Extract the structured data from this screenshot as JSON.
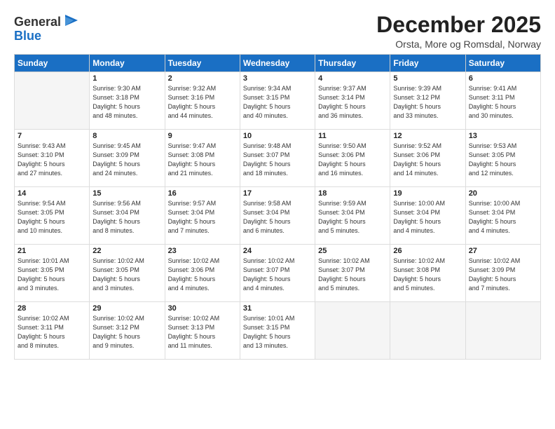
{
  "logo": {
    "general": "General",
    "blue": "Blue"
  },
  "header": {
    "month": "December 2025",
    "location": "Orsta, More og Romsdal, Norway"
  },
  "weekdays": [
    "Sunday",
    "Monday",
    "Tuesday",
    "Wednesday",
    "Thursday",
    "Friday",
    "Saturday"
  ],
  "weeks": [
    [
      {
        "num": "",
        "info": ""
      },
      {
        "num": "1",
        "info": "Sunrise: 9:30 AM\nSunset: 3:18 PM\nDaylight: 5 hours\nand 48 minutes."
      },
      {
        "num": "2",
        "info": "Sunrise: 9:32 AM\nSunset: 3:16 PM\nDaylight: 5 hours\nand 44 minutes."
      },
      {
        "num": "3",
        "info": "Sunrise: 9:34 AM\nSunset: 3:15 PM\nDaylight: 5 hours\nand 40 minutes."
      },
      {
        "num": "4",
        "info": "Sunrise: 9:37 AM\nSunset: 3:14 PM\nDaylight: 5 hours\nand 36 minutes."
      },
      {
        "num": "5",
        "info": "Sunrise: 9:39 AM\nSunset: 3:12 PM\nDaylight: 5 hours\nand 33 minutes."
      },
      {
        "num": "6",
        "info": "Sunrise: 9:41 AM\nSunset: 3:11 PM\nDaylight: 5 hours\nand 30 minutes."
      }
    ],
    [
      {
        "num": "7",
        "info": "Sunrise: 9:43 AM\nSunset: 3:10 PM\nDaylight: 5 hours\nand 27 minutes."
      },
      {
        "num": "8",
        "info": "Sunrise: 9:45 AM\nSunset: 3:09 PM\nDaylight: 5 hours\nand 24 minutes."
      },
      {
        "num": "9",
        "info": "Sunrise: 9:47 AM\nSunset: 3:08 PM\nDaylight: 5 hours\nand 21 minutes."
      },
      {
        "num": "10",
        "info": "Sunrise: 9:48 AM\nSunset: 3:07 PM\nDaylight: 5 hours\nand 18 minutes."
      },
      {
        "num": "11",
        "info": "Sunrise: 9:50 AM\nSunset: 3:06 PM\nDaylight: 5 hours\nand 16 minutes."
      },
      {
        "num": "12",
        "info": "Sunrise: 9:52 AM\nSunset: 3:06 PM\nDaylight: 5 hours\nand 14 minutes."
      },
      {
        "num": "13",
        "info": "Sunrise: 9:53 AM\nSunset: 3:05 PM\nDaylight: 5 hours\nand 12 minutes."
      }
    ],
    [
      {
        "num": "14",
        "info": "Sunrise: 9:54 AM\nSunset: 3:05 PM\nDaylight: 5 hours\nand 10 minutes."
      },
      {
        "num": "15",
        "info": "Sunrise: 9:56 AM\nSunset: 3:04 PM\nDaylight: 5 hours\nand 8 minutes."
      },
      {
        "num": "16",
        "info": "Sunrise: 9:57 AM\nSunset: 3:04 PM\nDaylight: 5 hours\nand 7 minutes."
      },
      {
        "num": "17",
        "info": "Sunrise: 9:58 AM\nSunset: 3:04 PM\nDaylight: 5 hours\nand 6 minutes."
      },
      {
        "num": "18",
        "info": "Sunrise: 9:59 AM\nSunset: 3:04 PM\nDaylight: 5 hours\nand 5 minutes."
      },
      {
        "num": "19",
        "info": "Sunrise: 10:00 AM\nSunset: 3:04 PM\nDaylight: 5 hours\nand 4 minutes."
      },
      {
        "num": "20",
        "info": "Sunrise: 10:00 AM\nSunset: 3:04 PM\nDaylight: 5 hours\nand 4 minutes."
      }
    ],
    [
      {
        "num": "21",
        "info": "Sunrise: 10:01 AM\nSunset: 3:05 PM\nDaylight: 5 hours\nand 3 minutes."
      },
      {
        "num": "22",
        "info": "Sunrise: 10:02 AM\nSunset: 3:05 PM\nDaylight: 5 hours\nand 3 minutes."
      },
      {
        "num": "23",
        "info": "Sunrise: 10:02 AM\nSunset: 3:06 PM\nDaylight: 5 hours\nand 4 minutes."
      },
      {
        "num": "24",
        "info": "Sunrise: 10:02 AM\nSunset: 3:07 PM\nDaylight: 5 hours\nand 4 minutes."
      },
      {
        "num": "25",
        "info": "Sunrise: 10:02 AM\nSunset: 3:07 PM\nDaylight: 5 hours\nand 5 minutes."
      },
      {
        "num": "26",
        "info": "Sunrise: 10:02 AM\nSunset: 3:08 PM\nDaylight: 5 hours\nand 5 minutes."
      },
      {
        "num": "27",
        "info": "Sunrise: 10:02 AM\nSunset: 3:09 PM\nDaylight: 5 hours\nand 7 minutes."
      }
    ],
    [
      {
        "num": "28",
        "info": "Sunrise: 10:02 AM\nSunset: 3:11 PM\nDaylight: 5 hours\nand 8 minutes."
      },
      {
        "num": "29",
        "info": "Sunrise: 10:02 AM\nSunset: 3:12 PM\nDaylight: 5 hours\nand 9 minutes."
      },
      {
        "num": "30",
        "info": "Sunrise: 10:02 AM\nSunset: 3:13 PM\nDaylight: 5 hours\nand 11 minutes."
      },
      {
        "num": "31",
        "info": "Sunrise: 10:01 AM\nSunset: 3:15 PM\nDaylight: 5 hours\nand 13 minutes."
      },
      {
        "num": "",
        "info": ""
      },
      {
        "num": "",
        "info": ""
      },
      {
        "num": "",
        "info": ""
      }
    ]
  ]
}
